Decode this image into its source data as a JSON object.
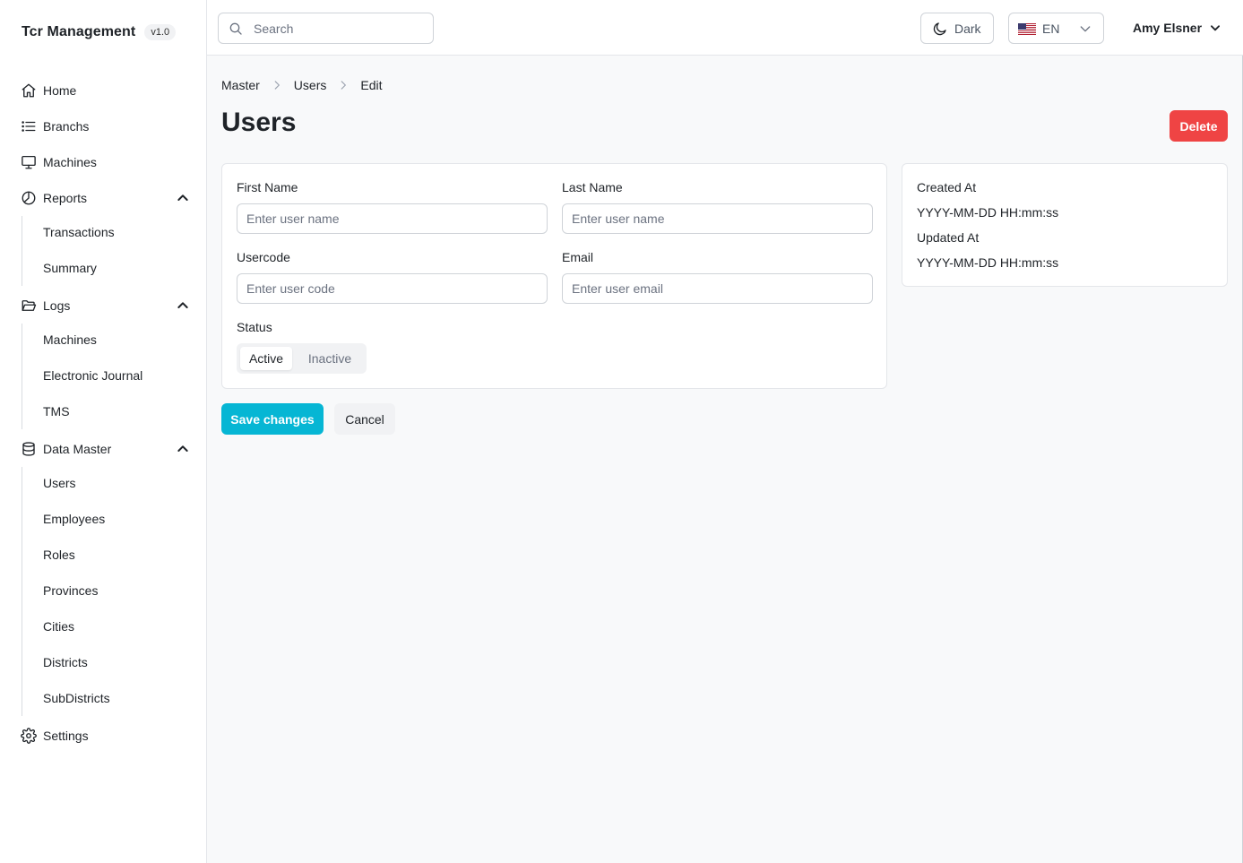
{
  "app": {
    "title": "Tcr Management",
    "version": "v1.0"
  },
  "sidebar": {
    "home": "Home",
    "branchs": "Branchs",
    "machines": "Machines",
    "reports": {
      "label": "Reports",
      "items": [
        "Transactions",
        "Summary"
      ]
    },
    "logs": {
      "label": "Logs",
      "items": [
        "Machines",
        "Electronic Journal",
        "TMS"
      ]
    },
    "data_master": {
      "label": "Data Master",
      "items": [
        "Users",
        "Employees",
        "Roles",
        "Provinces",
        "Cities",
        "Districts",
        "SubDistricts"
      ]
    },
    "settings": "Settings"
  },
  "topbar": {
    "search_placeholder": "Search",
    "theme_label": "Dark",
    "language": "EN",
    "user_name": "Amy Elsner"
  },
  "breadcrumb": [
    "Master",
    "Users",
    "Edit"
  ],
  "page": {
    "title": "Users",
    "delete_label": "Delete"
  },
  "form": {
    "first_name": {
      "label": "First Name",
      "value": "",
      "placeholder": "Enter user name"
    },
    "last_name": {
      "label": "Last Name",
      "value": "",
      "placeholder": "Enter user name"
    },
    "usercode": {
      "label": "Usercode",
      "value": "",
      "placeholder": "Enter user code"
    },
    "email": {
      "label": "Email",
      "value": "",
      "placeholder": "Enter user email"
    },
    "status": {
      "label": "Status",
      "options": [
        "Active",
        "Inactive"
      ],
      "selected": "Active"
    },
    "save_label": "Save changes",
    "cancel_label": "Cancel"
  },
  "info": {
    "created_label": "Created At",
    "created_value": "YYYY-MM-DD HH:mm:ss",
    "updated_label": "Updated At",
    "updated_value": "YYYY-MM-DD HH:mm:ss"
  },
  "colors": {
    "accent": "#06b6d4",
    "danger": "#ef4444",
    "text": "#1f2328",
    "muted": "#6b7280"
  }
}
